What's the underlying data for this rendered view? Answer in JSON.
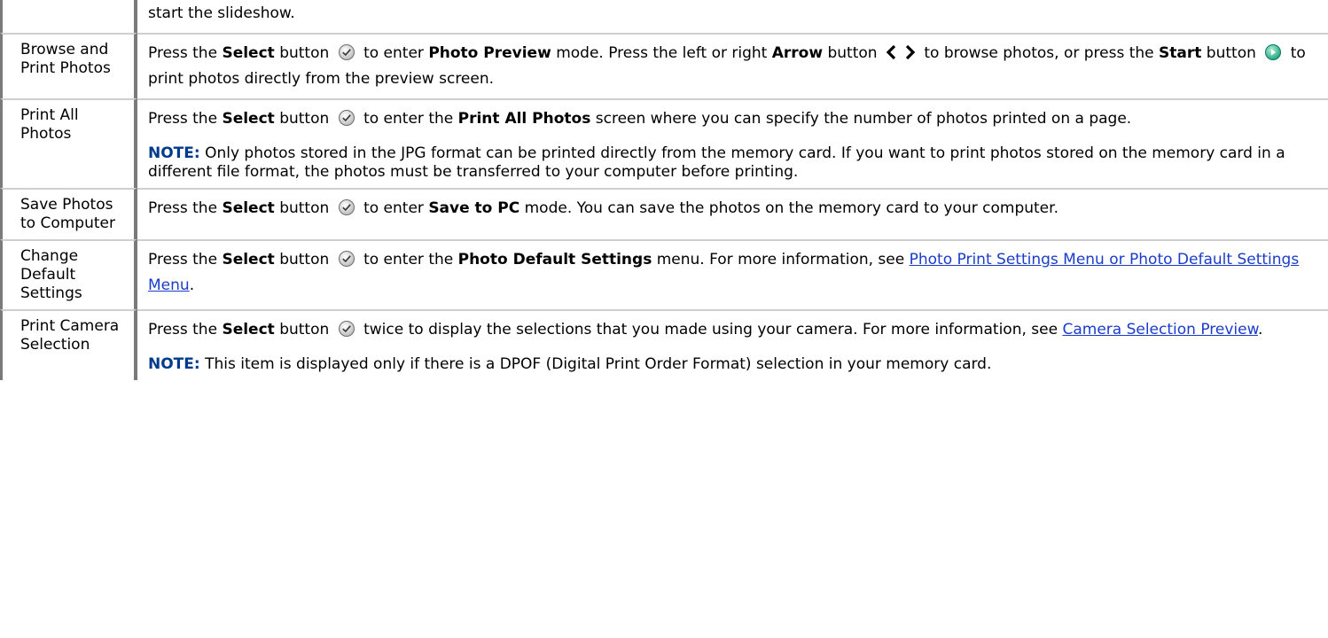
{
  "rows": [
    {
      "item": "",
      "desc_top": "start the slideshow."
    },
    {
      "item": "Browse and Print Photos",
      "p1": {
        "t1": "Press the ",
        "b1": "Select",
        "t2": " button ",
        "t3": " to enter ",
        "b2": "Photo Preview",
        "t4": " mode. Press the left or right ",
        "b3": "Arrow",
        "t5": " button ",
        "t6": " to browse photos, or press the ",
        "b4": "Start",
        "t7": " button ",
        "t8": " to print photos directly from the preview screen."
      }
    },
    {
      "item": "Print All Photos",
      "p1": {
        "t1": "Press the ",
        "b1": "Select",
        "t2": " button ",
        "t3": " to enter the ",
        "b2": "Print All Photos",
        "t4": " screen where you can specify the number of photos printed on a page."
      },
      "note": {
        "label": "NOTE:",
        "text": " Only photos stored in the JPG format can be printed directly from the memory card. If you want to print photos stored on the memory card in a different file format, the photos must be transferred to your computer before printing."
      }
    },
    {
      "item": "Save Photos to Computer",
      "p1": {
        "t1": "Press the ",
        "b1": "Select",
        "t2": " button ",
        "t3": " to enter ",
        "b2": "Save to PC",
        "t4": " mode. You can save the photos on the memory card to your computer."
      }
    },
    {
      "item": "Change Default Settings",
      "p1": {
        "t1": "Press the ",
        "b1": "Select",
        "t2": " button ",
        "t3": " to enter the ",
        "b2": "Photo Default Settings",
        "t4": " menu. For more information, see ",
        "link": "Photo Print Settings Menu or Photo Default Settings Menu",
        "t5": "."
      }
    },
    {
      "item": "Print Camera Selection",
      "p1": {
        "t1": "Press the ",
        "b1": "Select",
        "t2": " button ",
        "t3": " twice to display the selections that you made using your camera. For more information, see ",
        "link": "Camera Selection Preview",
        "t4": "."
      },
      "note": {
        "label": "NOTE:",
        "text": " This item is displayed only if there is a DPOF (Digital Print Order Format) selection in your memory card."
      }
    }
  ],
  "icons": {
    "select": "select-button-icon",
    "arrows": "left-right-arrow-icon",
    "start": "start-button-icon"
  },
  "colors": {
    "note_label": "#003a8c",
    "link": "#1a3ccc",
    "border_dark": "#7a7a7a",
    "border_light": "#cfcfcf"
  }
}
